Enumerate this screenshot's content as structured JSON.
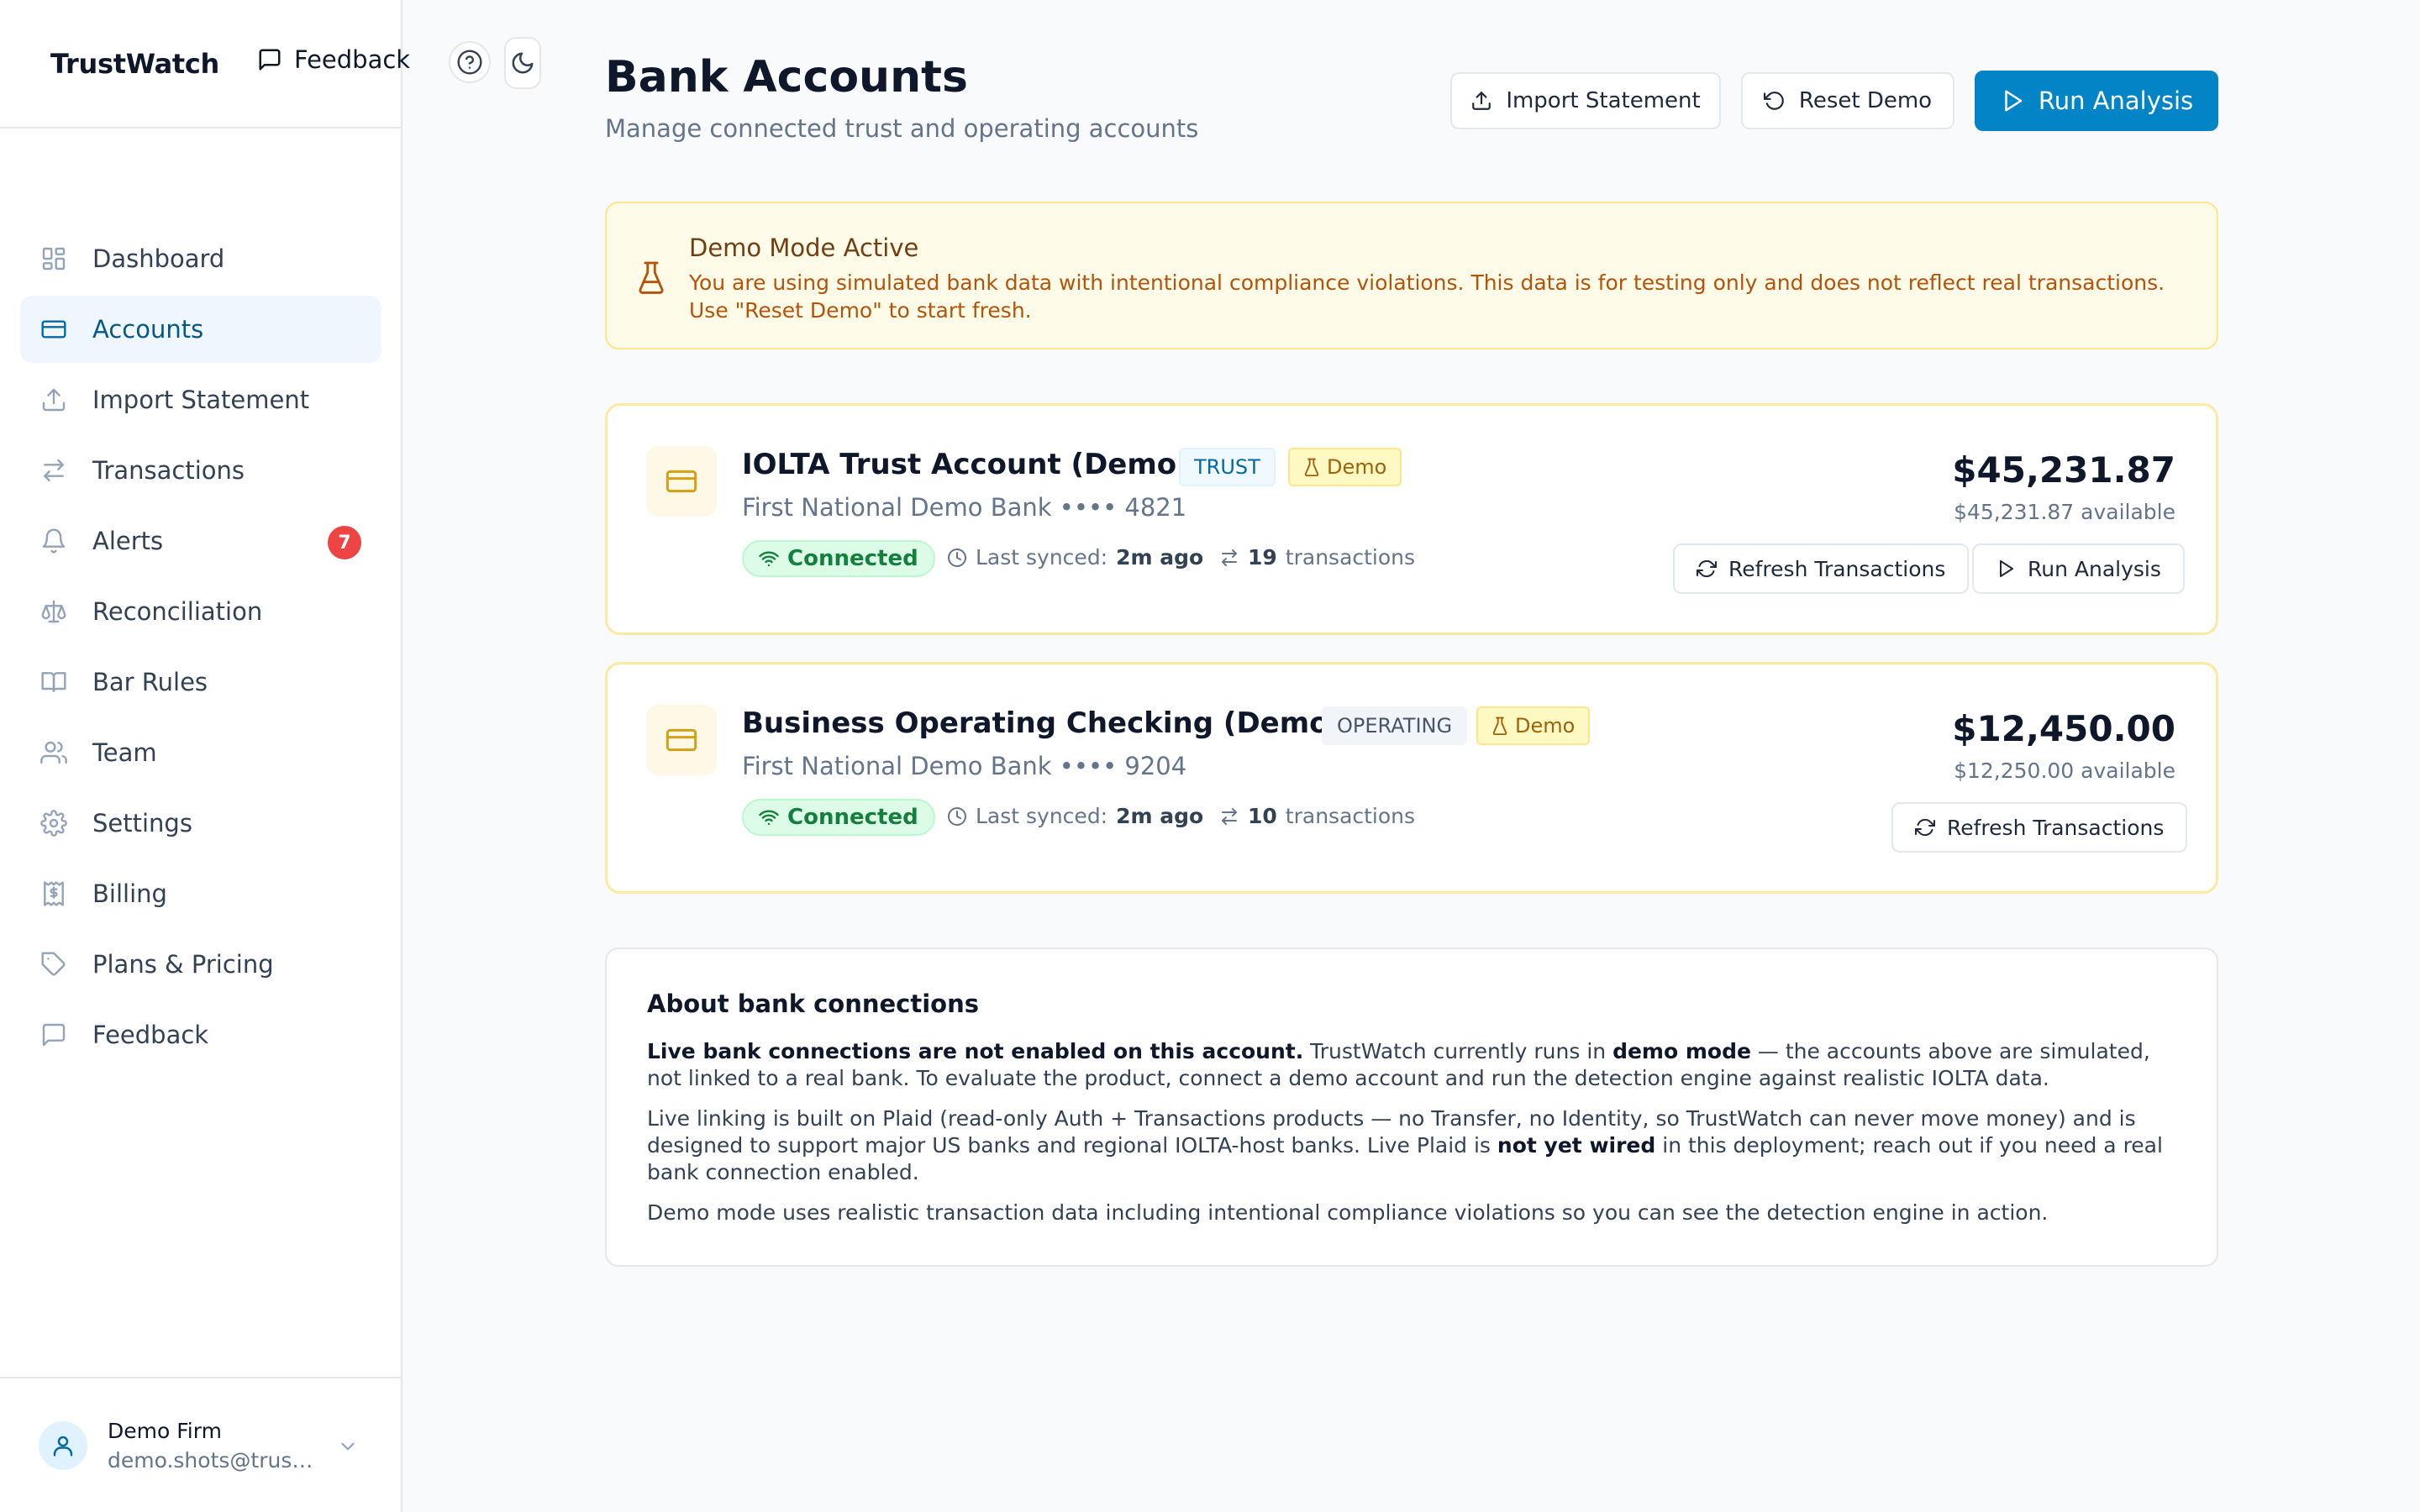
{
  "app": {
    "name": "TrustWatch",
    "feedback_label": "Feedback"
  },
  "sidebar": {
    "items": [
      {
        "label": "Dashboard",
        "icon": "dashboard-icon"
      },
      {
        "label": "Accounts",
        "icon": "credit-card-icon",
        "active": true
      },
      {
        "label": "Import Statement",
        "icon": "upload-icon"
      },
      {
        "label": "Transactions",
        "icon": "arrows-swap-icon"
      },
      {
        "label": "Alerts",
        "icon": "bell-icon",
        "badge": "7"
      },
      {
        "label": "Reconciliation",
        "icon": "scale-icon"
      },
      {
        "label": "Bar Rules",
        "icon": "book-icon"
      },
      {
        "label": "Team",
        "icon": "users-icon"
      },
      {
        "label": "Settings",
        "icon": "gear-icon"
      },
      {
        "label": "Billing",
        "icon": "receipt-icon"
      },
      {
        "label": "Plans & Pricing",
        "icon": "tag-icon"
      },
      {
        "label": "Feedback",
        "icon": "message-icon"
      }
    ],
    "user": {
      "name": "Demo Firm",
      "email": "demo.shots@trustwatch.app"
    }
  },
  "page": {
    "title": "Bank Accounts",
    "subtitle": "Manage connected trust and operating accounts",
    "actions": {
      "import": "Import Statement",
      "reset": "Reset Demo",
      "run": "Run Analysis"
    }
  },
  "banner": {
    "title": "Demo Mode Active",
    "text": "You are using simulated bank data with intentional compliance violations. This data is for testing only and does not reflect real transactions. Use \"Reset Demo\" to start fresh."
  },
  "accounts": [
    {
      "name": "IOLTA Trust Account (Demo)",
      "type_tag": "TRUST",
      "demo_tag": "Demo",
      "bank": "First National Demo Bank •••• 4821",
      "status": "Connected",
      "synced_label": "Last synced:",
      "synced_value": "2m ago",
      "tx_count": "19",
      "tx_label": "transactions",
      "balance": "$45,231.87",
      "available": "$45,231.87 available",
      "refresh_label": "Refresh Transactions",
      "run_label": "Run Analysis"
    },
    {
      "name": "Business Operating Checking (Demo)",
      "type_tag": "OPERATING",
      "demo_tag": "Demo",
      "bank": "First National Demo Bank •••• 9204",
      "status": "Connected",
      "synced_label": "Last synced:",
      "synced_value": "2m ago",
      "tx_count": "10",
      "tx_label": "transactions",
      "balance": "$12,450.00",
      "available": "$12,250.00 available",
      "refresh_label": "Refresh Transactions"
    }
  ],
  "about": {
    "title": "About bank connections",
    "p1_bold": "Live bank connections are not enabled on this account.",
    "p1_a": " TrustWatch currently runs in ",
    "p1_bold2": "demo mode",
    "p1_b": " — the accounts above are simulated, not linked to a real bank. To evaluate the product, connect a demo account and run the detection engine against realistic IOLTA data.",
    "p2_a": "Live linking is built on Plaid (read-only Auth + Transactions products — no Transfer, no Identity, so TrustWatch can never move money) and is designed to support major US banks and regional IOLTA-host banks. Live Plaid is ",
    "p2_bold": "not yet wired",
    "p2_b": " in this deployment; reach out if you need a real bank connection enabled.",
    "p3": "Demo mode uses realistic transaction data including intentional compliance violations so you can see the detection engine in action."
  },
  "colors": {
    "accent": "#0284c7",
    "connected": "#15803d",
    "alert_badge": "#ef4444",
    "demo": "#a16207"
  }
}
